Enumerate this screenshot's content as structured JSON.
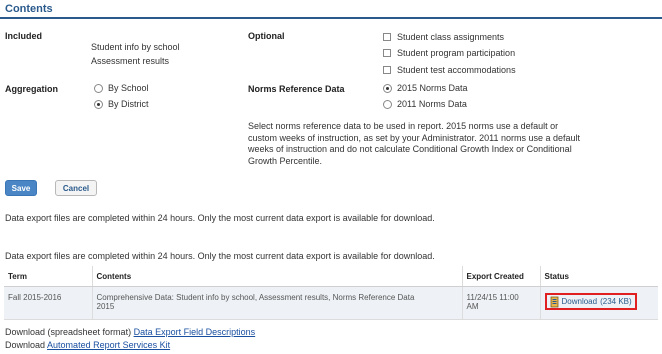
{
  "section": {
    "title": "Contents"
  },
  "included": {
    "label": "Included",
    "items": [
      "Student info by school",
      "Assessment results"
    ]
  },
  "optional": {
    "label": "Optional",
    "items": [
      {
        "label": "Student class assignments",
        "checked": false
      },
      {
        "label": "Student program participation",
        "checked": false
      },
      {
        "label": "Student test accommodations",
        "checked": false
      }
    ]
  },
  "aggregation": {
    "label": "Aggregation",
    "options": [
      {
        "label": "By School",
        "selected": false
      },
      {
        "label": "By District",
        "selected": true
      }
    ]
  },
  "norms": {
    "label": "Norms Reference Data",
    "options": [
      {
        "label": "2015 Norms Data",
        "selected": true
      },
      {
        "label": "2011 Norms Data",
        "selected": false
      }
    ],
    "help_lines": [
      "Select norms reference data to be used in report. 2015 norms use a default or",
      "custom weeks of instruction, as set by your Administrator. 2011 norms use a default",
      "weeks of instruction and do not calculate Conditional Growth Index or Conditional",
      "Growth Percentile."
    ]
  },
  "buttons": {
    "save": "Save",
    "cancel": "Cancel"
  },
  "notice1": "Data export files are completed within 24 hours. Only the most current data export is available for download.",
  "notice2": "Data export files are completed within 24 hours. Only the most current data export is available for download.",
  "table": {
    "headers": {
      "term": "Term",
      "contents": "Contents",
      "created": "Export Created",
      "status": "Status"
    },
    "rows": [
      {
        "term": "Fall 2015-2016",
        "contents_l1": "Comprehensive Data: Student info by school, Assessment results, Norms Reference Data",
        "contents_l2": "2015",
        "created_l1": "11/24/15 11:00",
        "created_l2": "AM",
        "download_label": "Download",
        "download_size": "(234 KB)"
      }
    ]
  },
  "footer": {
    "line1_prefix": "Download (spreadsheet format)",
    "line1_link": "Data Export Field Descriptions",
    "line2_prefix": "Download",
    "line2_link": "Automated Report Services Kit"
  },
  "colors": {
    "accent": "#2a5a8c",
    "button": "#4a86c5",
    "highlight": "#e02020"
  }
}
